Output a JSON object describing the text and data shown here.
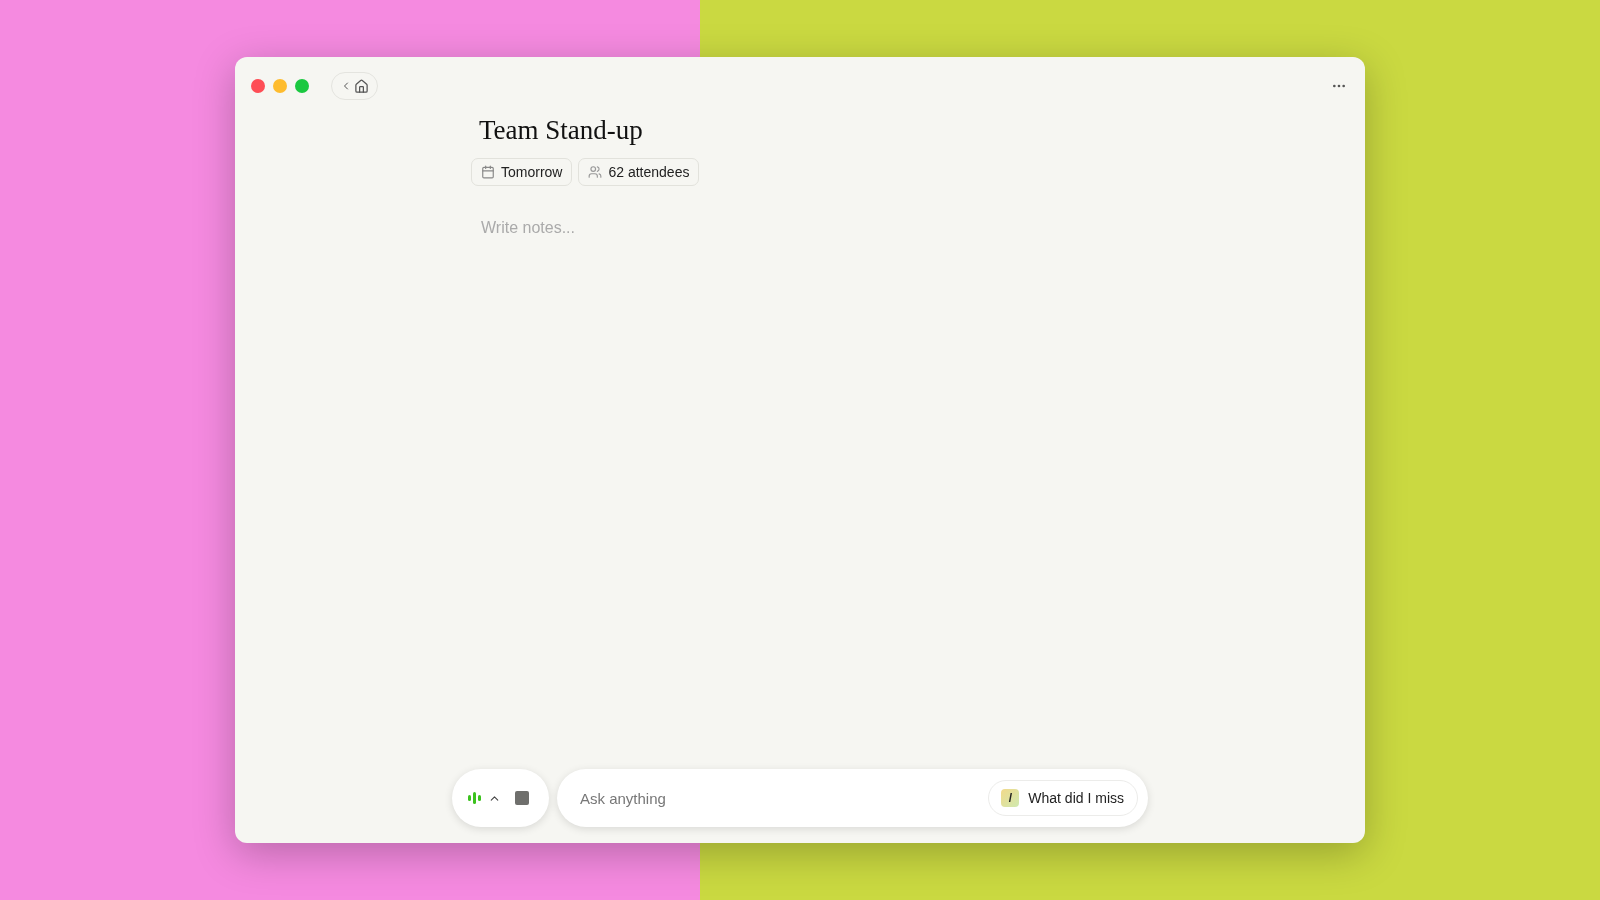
{
  "note": {
    "title": "Team Stand-up",
    "chips": [
      {
        "kind": "date",
        "label": "Tomorrow"
      },
      {
        "kind": "attendees",
        "label": "62 attendees"
      }
    ],
    "body": {
      "placeholder": "Write notes..."
    }
  },
  "ask": {
    "placeholder": "Ask anything",
    "suggestion": {
      "shortcut": "/",
      "label": "What did I miss"
    }
  }
}
